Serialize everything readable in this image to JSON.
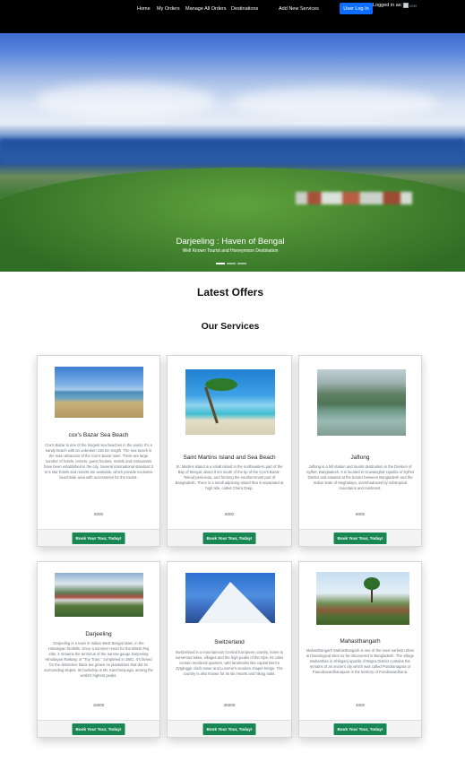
{
  "nav": {
    "links": [
      "Home",
      "My Orders",
      "Manage All Orders",
      "Destinations",
      "Add New Services"
    ],
    "login_label": "User Log In",
    "logged_in_text": "Logged in as:",
    "avatar_alt": "user"
  },
  "hero": {
    "title": "Darjeeling : Haven of Bengal",
    "subtitle": "Well Known Tourist and Honeymoon Destination",
    "slide_count": 3,
    "active_slide": 1
  },
  "headings": {
    "offers": "Latest Offers",
    "services": "Our Services"
  },
  "book_label": "Book Your Tour, Today!",
  "services": [
    {
      "title": "cox's Bazar Sea Beach",
      "image_icon": "beach-photo",
      "description": "Cox's Bazar is one of the longest sea beaches in the world. It's a sandy beach with an unbroken 155 km length. The sea beach is the main attraction of the Cox's Bazar town. There are large number of hotels, resorts, guest houses, motels and restaurants have been established in the city. Several international standard 3 to 5 star hotels and resorts are available, which provide exclusive beachside area with accessories for the tourist.",
      "price": "5000"
    },
    {
      "title": "Saint Martins Island and Sea Beach",
      "image_icon": "palm-beach-photo",
      "description": "St. Martins island is a small island in the northeastern part of the Bay of Bengal, about 9 km south of the tip of the Cox's Bazar-Teknaf peninsula, and forming the southernmost part of Bangladesh. There is a small adjoining island that is separated at high tide, called Chera Dwip.",
      "price": "6000"
    },
    {
      "title": "Jaflong",
      "image_icon": "river-hills-photo",
      "description": "Jaflong is a hill station and tourist destination in the Division of Sylhet, Bangladesh. It is located in Gowainghat Upazila of Sylhet District and situated at the border between Bangladesh and the Indian state of Meghalaya, overshadowed by subtropical mountains and rainforest.",
      "price": "8000"
    },
    {
      "title": "Darjeeling",
      "image_icon": "hill-town-photo",
      "description": "Darjeeling is a town in Indian West Bengal state, in the Himalayan foothills. Once a summer resort for the British Raj elite, it remains the terminus of the narrow-gauge Darjeeling Himalayan Railway, or “Toy Train,” completed in 1881. It’s famed for the distinctive black tea grown on plantations that dot its surrounding slopes. Its backdrop is Mt. Kanchenjunga, among the world’s highest peaks.",
      "price": "15000"
    },
    {
      "title": "Switzerland",
      "image_icon": "mountain-photo",
      "description": "Switzerland is a mountainous Central European country, home to numerous lakes, villages and the high peaks of the Alps. Its cities contain medieval quarters, with landmarks like capital Bern’s Zytglogge clock tower and Lucerne’s wooden chapel bridge. The country is also known for its ski resorts and hiking trails.",
      "price": "35000"
    },
    {
      "title": "Mahasthangarh",
      "image_icon": "ruins-photo",
      "description": "Mahasthangarh Mahasthangarh is one of the most earliest urban archaeological sites so far discovered in Bangladesh. The village Mahasthan in Shibganj upazila of Bogra District contains the remains of an ancient city which was called Pundranagara or Paundravardhanapura in the territory of Pundravardhana.",
      "price": "4000"
    }
  ]
}
